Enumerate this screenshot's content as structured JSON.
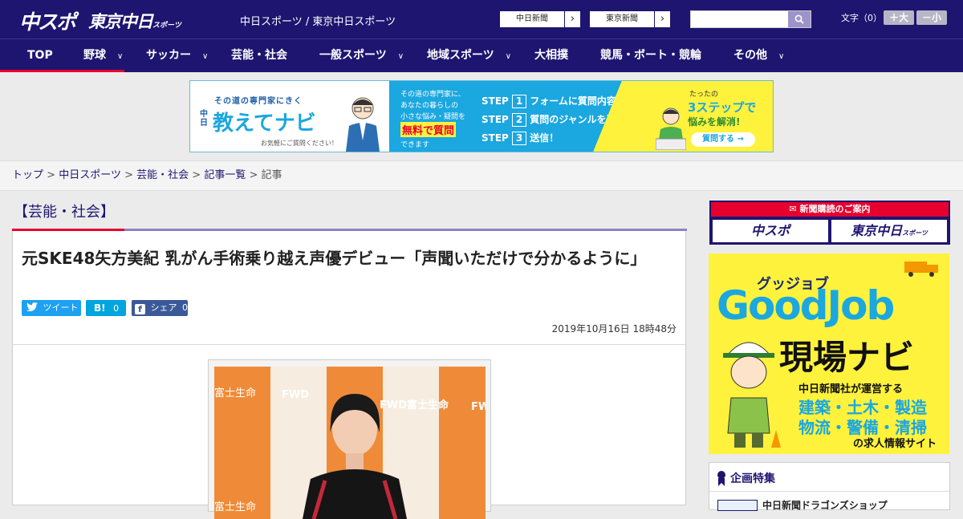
{
  "header": {
    "logo_main": "中スポ",
    "logo_tokyo": "東京中日",
    "logo_tokyo_suffix": "スポーツ",
    "site_names": "中日スポーツ / 東京中日スポーツ",
    "chunichi_button": "中日新聞",
    "tokyo_button": "東京新聞",
    "font_size_label": "文字（0）",
    "font_larger": "＋大",
    "font_smaller": "－小"
  },
  "nav": {
    "items": [
      {
        "label": "TOP"
      },
      {
        "label": "野球"
      },
      {
        "label": "サッカー"
      },
      {
        "label": "芸能・社会"
      },
      {
        "label": "一般スポーツ"
      },
      {
        "label": "地域スポーツ"
      },
      {
        "label": "大相撲"
      },
      {
        "label": "競馬・ボート・競輪"
      },
      {
        "label": "その他"
      }
    ]
  },
  "banner": {
    "tagline": "その道の専門家にきく",
    "brand_prefix": "中日",
    "brand": "教えてナビ",
    "note": "お気軽にご質問ください！",
    "mid_line1": "その道の専門家に、",
    "mid_line2": "あなたの暮らしの",
    "mid_line3": "小さな悩み・疑問を",
    "mid_free": "無料で質問",
    "mid_end": "できます",
    "steps": [
      {
        "label": "STEP",
        "num": "1",
        "text": "フォームに質問内容を入力"
      },
      {
        "label": "STEP",
        "num": "2",
        "text": "質問のジャンルを選択"
      },
      {
        "label": "STEP",
        "num": "3",
        "text": "送信！"
      }
    ],
    "right_small": "たったの",
    "right_big": "3ステップで",
    "right_sub": "悩みを解消!",
    "cta": "質問する"
  },
  "breadcrumb": {
    "items": [
      "トップ",
      "中日スポーツ",
      "芸能・社会",
      "記事一覧"
    ],
    "current": "記事",
    "separator": ">"
  },
  "article": {
    "category": "【芸能・社会】",
    "title": "元SKE48矢方美紀 乳がん手術乗り越え声優デビュー「声聞いただけで分かるように」",
    "tweet_label": "ツイート",
    "hatena_label": "B!",
    "hatena_count": "0",
    "fb_label": "シェア",
    "fb_count": "0",
    "date": "2019年10月16日 18時48分",
    "photo_texts": [
      "富士生命",
      "FWD",
      "FWD富士生命",
      "FWD",
      "富士生命"
    ]
  },
  "sidebar": {
    "subscribe_header": "新聞購読のご案内",
    "subscribe_a": "中スポ",
    "subscribe_b": "東京中日",
    "subscribe_b_suffix": "スポーツ",
    "goodjob_kana": "グッジョブ",
    "goodjob_logo": "GoodJob",
    "goodjob_title": "現場ナビ",
    "goodjob_line1": "中日新聞社が運営する",
    "goodjob_line2": "建築・土木・製造",
    "goodjob_line3": "物流・警備・清掃",
    "goodjob_line4": "の求人情報サイト",
    "special_title": "企画特集",
    "special_item": "中日新聞ドラゴンズショップ"
  },
  "colors": {
    "brand_navy": "#1e1570",
    "accent_red": "#e6002e",
    "twitter": "#1da1f2",
    "hatena": "#00a4de",
    "facebook": "#3b5998"
  }
}
